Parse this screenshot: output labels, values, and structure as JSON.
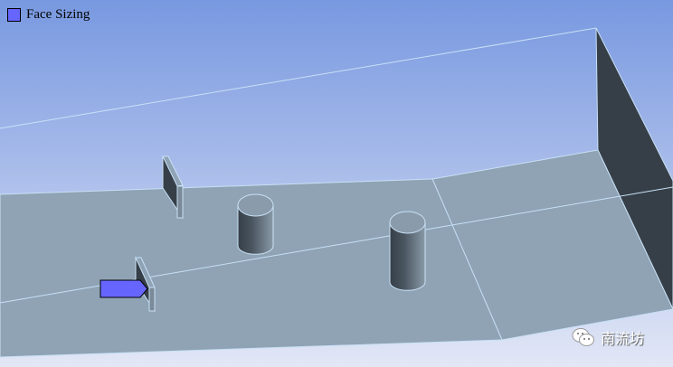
{
  "legend": {
    "label": "Face Sizing",
    "color": "#6666ff"
  },
  "watermark": {
    "text": "南流坊",
    "icon": "wechat-icon"
  },
  "colors": {
    "floor": "#8fa3b5",
    "wall": "#363f48",
    "edge": "#c8e0f5",
    "highlight": "#6666ff"
  }
}
